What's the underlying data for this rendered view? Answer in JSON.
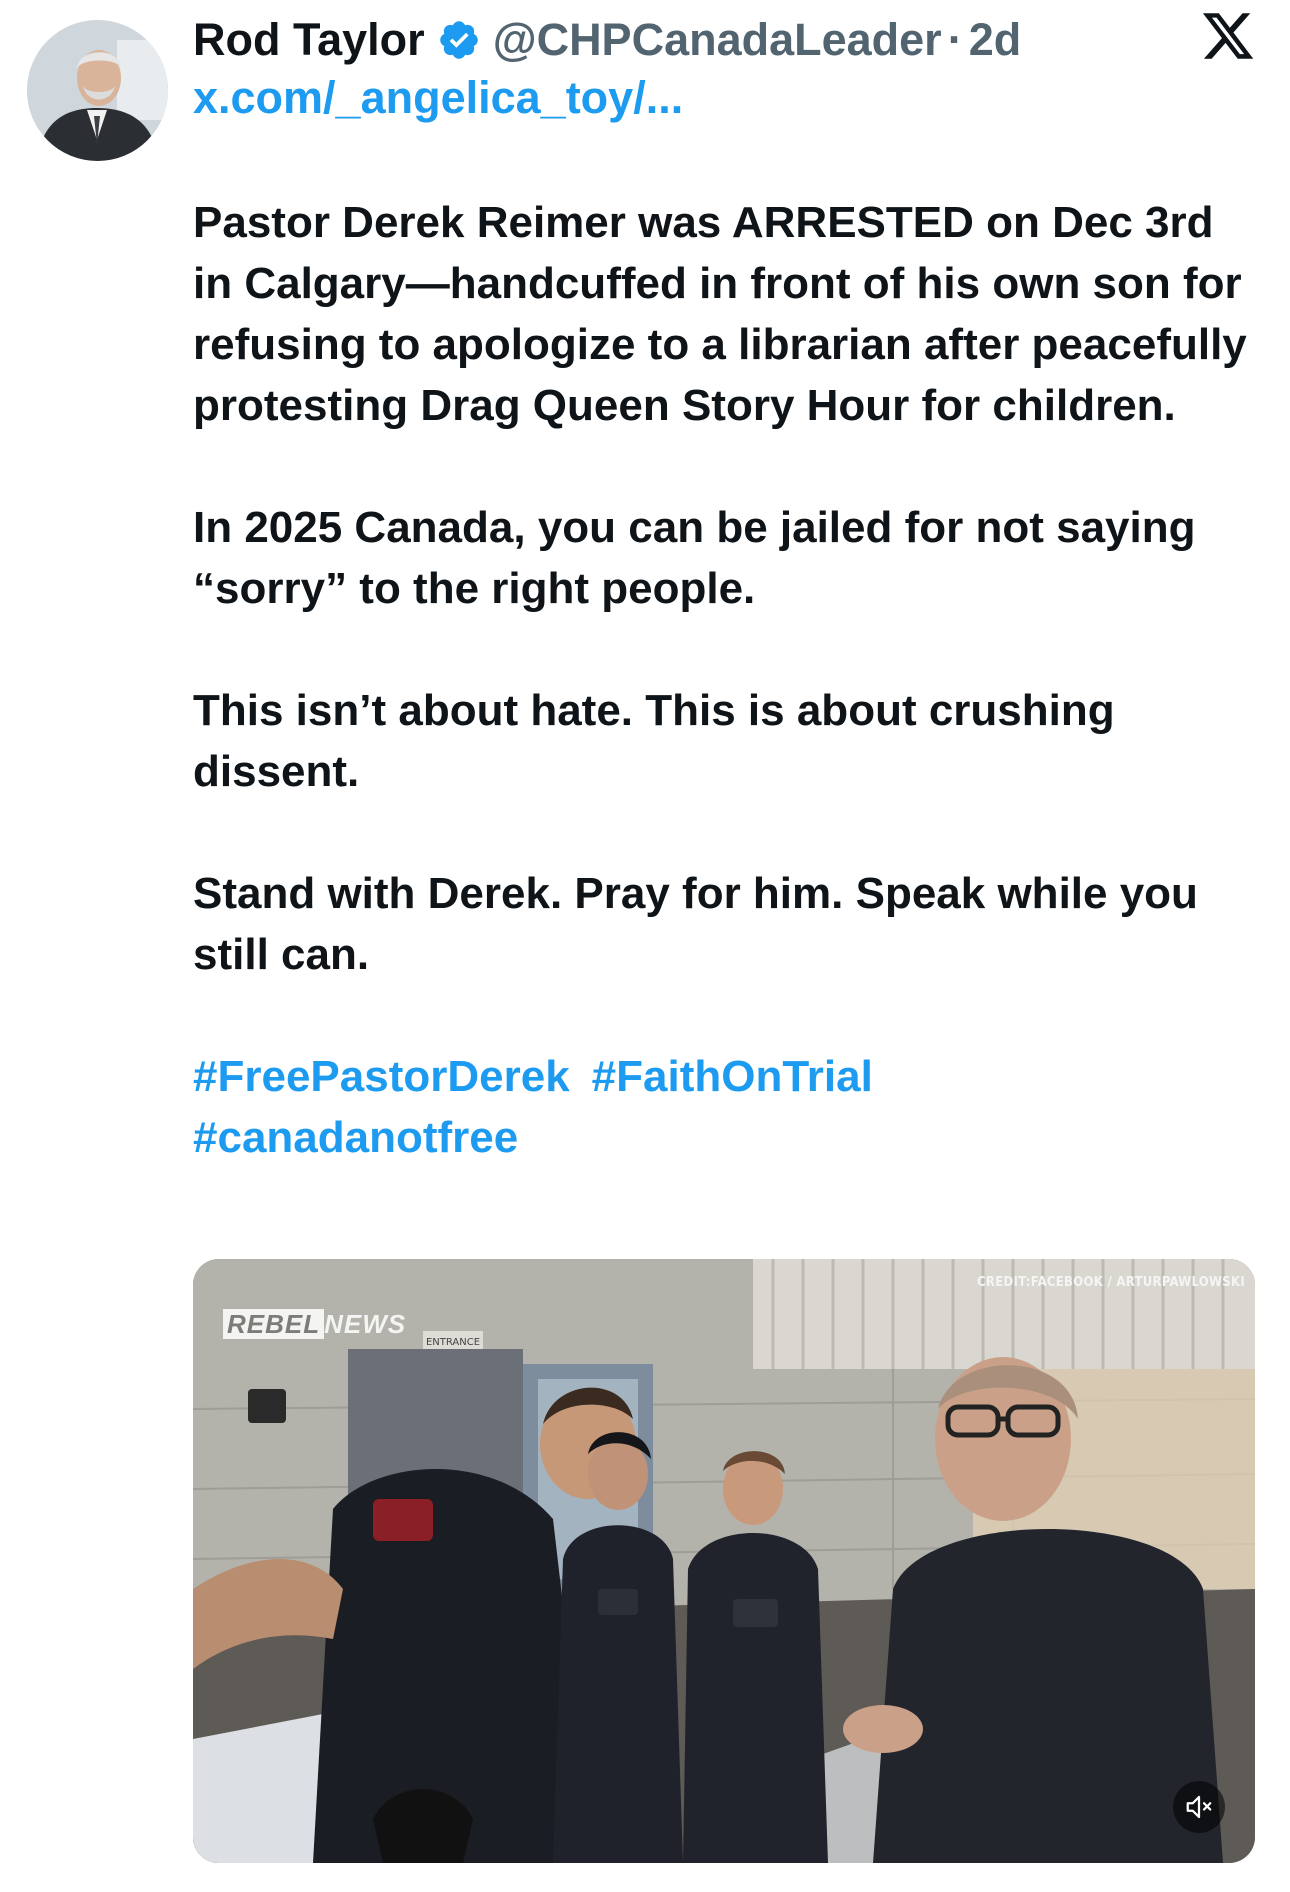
{
  "author": {
    "display_name": "Rod Taylor",
    "handle": "@CHPCanadaLeader",
    "separator": "·",
    "time": "2d",
    "verified": true,
    "verified_color": "#1d9bf0"
  },
  "quote_link": "x.com/_angelica_toy/...",
  "body": {
    "paragraphs": [
      "Pastor Derek Reimer was ARRESTED on  Dec 3rd in Calgary—handcuffed in front of his own son for refusing to apologize to a librarian after peacefully protesting Drag Queen Story Hour for children.",
      "In 2025 Canada, you can be jailed for not saying “sorry” to the right people.",
      "This isn’t about hate. This is about crushing dissent.",
      "Stand with Derek. Pray for him. Speak while you still can."
    ],
    "hashtags": [
      "#FreePastorDerek",
      "#FaithOnTrial",
      "#canadanotfree"
    ]
  },
  "media": {
    "type": "video",
    "credit": "CREDIT:FACEBOOK / ARTURPAWLOWSKI",
    "watermark_part1": "REBEL",
    "watermark_part2": "NEWS",
    "entrance_sign": "ENTRANCE"
  },
  "icons": {
    "avatar": "avatar-photo",
    "verified": "verified-badge-icon",
    "platform": "x-logo-icon",
    "mute": "speaker-muted-icon"
  },
  "colors": {
    "link": "#1d9bf0",
    "text": "#0f1419",
    "secondary": "#536471"
  }
}
